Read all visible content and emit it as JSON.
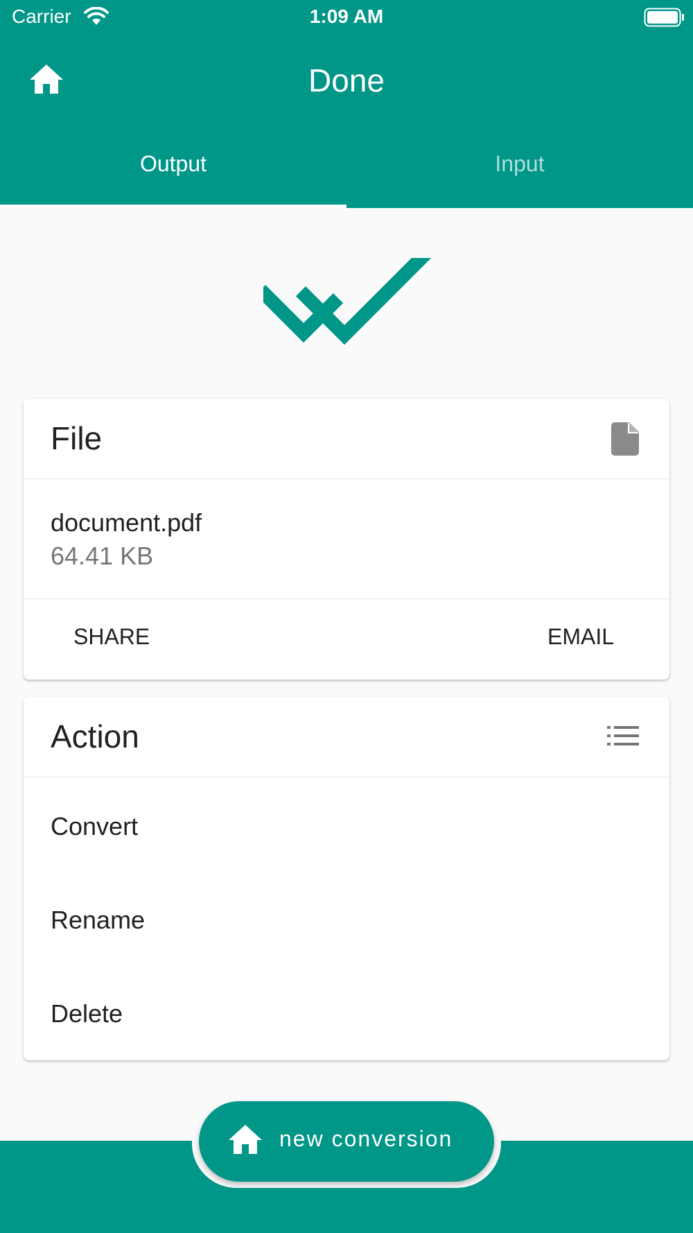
{
  "colors": {
    "primary": "#009688",
    "background": "#fafafa",
    "text": "#212121",
    "muted": "#757575",
    "icon_gray": "#8a8a8a"
  },
  "status_bar": {
    "carrier": "Carrier",
    "time": "1:09 AM",
    "wifi_icon": "wifi-icon",
    "battery_icon": "battery-icon"
  },
  "header": {
    "title": "Done",
    "home_icon": "home-icon"
  },
  "tabs": [
    {
      "label": "Output",
      "active": true
    },
    {
      "label": "Input",
      "active": false
    }
  ],
  "hero_icon": "double-check-icon",
  "file_card": {
    "title": "File",
    "icon": "file-icon",
    "file_name": "document.pdf",
    "file_size": "64.41 KB",
    "share_label": "SHARE",
    "email_label": "EMAIL"
  },
  "action_card": {
    "title": "Action",
    "icon": "list-icon",
    "items": [
      {
        "label": "Convert"
      },
      {
        "label": "Rename"
      },
      {
        "label": "Delete"
      }
    ]
  },
  "fab": {
    "label": "new conversion",
    "icon": "home-icon"
  }
}
